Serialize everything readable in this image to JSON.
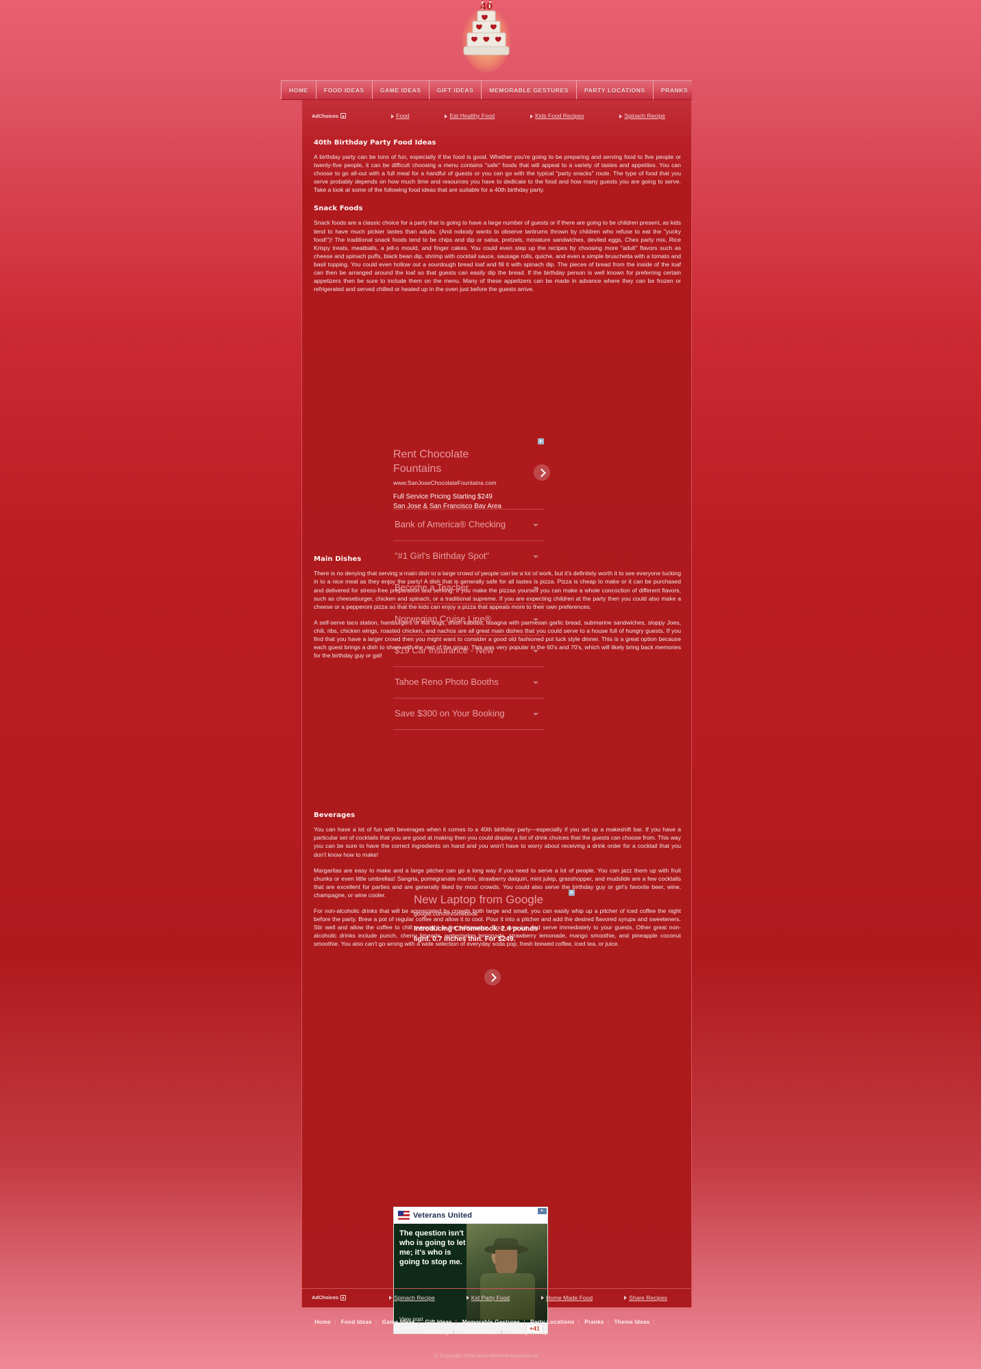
{
  "site": {
    "logo_icon": "birthday-cake-icon",
    "nav": [
      {
        "label": "HOME"
      },
      {
        "label": "FOOD IDEAS"
      },
      {
        "label": "GAME IDEAS"
      },
      {
        "label": "GIFT IDEAS"
      },
      {
        "label": "MEMORABLE GESTURES"
      },
      {
        "label": "PARTY LOCATIONS"
      },
      {
        "label": "PRANKS"
      }
    ]
  },
  "ad_strip_top": {
    "adchoices_label": "AdChoices",
    "links": [
      {
        "label": "Food"
      },
      {
        "label": "Eat Healthy Food"
      },
      {
        "label": "Kids Food Recipes"
      },
      {
        "label": "Spinach Recipe"
      }
    ]
  },
  "ad_strip_bottom": {
    "adchoices_label": "AdChoices",
    "links": [
      {
        "label": "Spinach Recipe"
      },
      {
        "label": "Kid Party Food"
      },
      {
        "label": "Home Made Food"
      },
      {
        "label": "Share Recipes"
      }
    ]
  },
  "article": {
    "title": "40th Birthday Party Food Ideas",
    "intro": "A birthday party can be tons of fun, especially if the food is good. Whether you're going to be preparing and serving food to five people or twenty-five people, it can be difficult choosing a menu contains \"safe\" foods that will appeal to a variety of tastes and appetites. You can choose to go all-out with a full meal for a handful of guests or you can go with the typical \"party snacks\" route. The type of food that you serve probably depends on how much time and resources you have to dedicate to the food and how many guests you are going to serve. Take a look at some of the following food ideas that are suitable for a 40th birthday party.",
    "snack_heading": "Snack Foods",
    "snack_text": "Snack foods are a classic choice for a party that is going to have a large number of guests or if there are going to be children present, as kids tend to have much pickier tastes than adults. (And nobody wants to observe tantrums thrown by children who refuse to eat the \"yucky food!\")! The traditional snack foods tend to be chips and dip or salsa, pretzels, miniature sandwiches, deviled eggs, Chex party mix, Rice Krispy treats, meatballs, a jell-o mould, and finger cakes. You could even step up the recipes by choosing more \"adult\" flavors such as cheese and spinach puffs, black bean dip, shrimp with cocktail sauce, sausage rolls, quiche, and even a simple bruschetta with a tomato and basil topping. You could even hollow out a sourdough bread loaf and fill it with spinach dip. The pieces of bread from the inside of the loaf can then be arranged around the loaf so that guests can easily dip the bread. If the birthday person is well known for preferring certain appetizers then be sure to include them on the menu. Many of these appetizers can be made in advance where they can be frozen or refrigerated and served chilled or heated up in the oven just before the guests arrive.",
    "main_heading": "Main Dishes",
    "main_text_1": "There is no denying that serving a main dish to a large crowd of people can be a lot of work, but it's definitely worth it to see everyone tucking in to a nice meal as they enjoy the party! A dish that is generally safe for all tastes is pizza. Pizza is cheap to make or it can be purchased and delivered for stress-free preparation and serving. If you make the pizzas yourself you can make a whole concoction of different flavors, such as cheeseburger, chicken and spinach, or a traditional supreme. If you are expecting children at the party then you could also make a cheese or a pepperoni pizza so that the kids can enjoy a pizza that appeals more to their own preferences.",
    "main_text_2": "A self-serve taco station, hamburgers or hot dogs, shish kabobs, lasagna with parmesan garlic bread, submarine sandwiches, sloppy Joes, chili, ribs, chicken wings, roasted chicken, and nachos are all great main dishes that you could serve to a house full of hungry guests. If you find that you have a larger crowd then you might want to consider a good old fashioned pot luck style dinner. This is a great option because each guest brings a dish to share with the rest of the group. This was very popular in the 60's and 70's, which will likely bring back memories for the birthday guy or gal!",
    "bev_heading": "Beverages",
    "bev_text_1": "You can have a lot of fun with beverages when it comes to a 40th birthday party—especially if you set up a makeshift bar. If you have a particular set of cocktails that you are good at making then you could display a list of drink choices that the guests can choose from. This way you can be sure to have the correct ingredients on hand and you won't have to worry about receiving a drink order for a cocktail that you don't know how to make!",
    "bev_text_2": "Margaritas are easy to make and a large pitcher can go a long way if you need to serve a lot of people. You can jazz them up with fruit chunks or even little umbrellas! Sangria, pomegranate martini, strawberry daiquiri, mint julep, grasshopper, and mudslide are a few cocktails that are excellent for parties and are generally liked by most crowds. You could also serve the birthday guy or girl's favorite beer, wine, champagne, or wine cooler.",
    "bev_text_3": "For non-alcoholic drinks that will be appreciated by crowds both large and small, you can easily whip up a pitcher of iced coffee the night before the party. Brew a pot of regular coffee and allow it to cool. Pour it into a pitcher and add the desired flavored syrups and sweeteners. Stir well and allow the coffee to chill overnight in the refrigerator. Pour over ice and serve immediately to your guests. Other great non-alcoholic drinks include punch, cherry limeade, watermelon lemonade, strawberry lemonade, mango smoothie, and pineapple coconut smoothie. You also can't go wrong with a wide selection of everyday soda pop, fresh brewed coffee, iced tea, or juice."
  },
  "ad_unit_1": {
    "headline": "Rent Chocolate Fountains",
    "url": "www.SanJoseChocolateFountains.com",
    "desc_line1": "Full Service Pricing Starting $249",
    "desc_line2": "San Jose & San Francisco Bay Area",
    "next_icon": "chevron-right-icon",
    "info_icon": "ad-info-icon",
    "items": [
      {
        "label": "Bank of America® Checking"
      },
      {
        "label": "\"#1 Girl's Birthday Spot\""
      },
      {
        "label": "Become a Teacher"
      },
      {
        "label": "Norwegian Cruise Line®"
      },
      {
        "label": "$19 Car Insurance - New"
      },
      {
        "label": "Tahoe Reno Photo Booths"
      },
      {
        "label": "Save $300 on Your Booking"
      }
    ]
  },
  "ad_unit_2": {
    "headline": "New Laptop from Google",
    "url": "google.com/chromebook",
    "desc": "Introducing Chromebook. 2.4 pounds light. 0.7 inches thin. For $249.",
    "next_icon": "chevron-right-icon",
    "info_icon": "ad-info-icon"
  },
  "ad_unit_3": {
    "advertiser": "Veterans United",
    "headline": "The question isn't who is going to let me; it's who is going to stop me.",
    "view_post_label": "View post",
    "plus_count": "+41",
    "flag_icon": "us-flag-icon",
    "info_icon": "ad-info-icon"
  },
  "footer": {
    "links_row1": [
      {
        "label": "Home"
      },
      {
        "label": "Food Ideas"
      },
      {
        "label": "Game Ideas"
      },
      {
        "label": "Gift Ideas"
      },
      {
        "label": "Memorable Gestures"
      },
      {
        "label": "Party Locations"
      },
      {
        "label": "Pranks"
      },
      {
        "label": "Theme Ideas"
      }
    ],
    "links_row2": [
      {
        "label": "Site Map"
      },
      {
        "label": "Terms Of Use"
      },
      {
        "label": "Privacy Policy"
      }
    ],
    "copyright": "© Copyright 2008 www.40thbirthdayideas.net"
  },
  "colors": {
    "page_bg_top": "#e8606f",
    "page_bg_mid": "#b01a1d",
    "panel_bg": "#ab1a1c",
    "nav_text": "#f6d8dc",
    "ad_headline": "#e89da3"
  }
}
